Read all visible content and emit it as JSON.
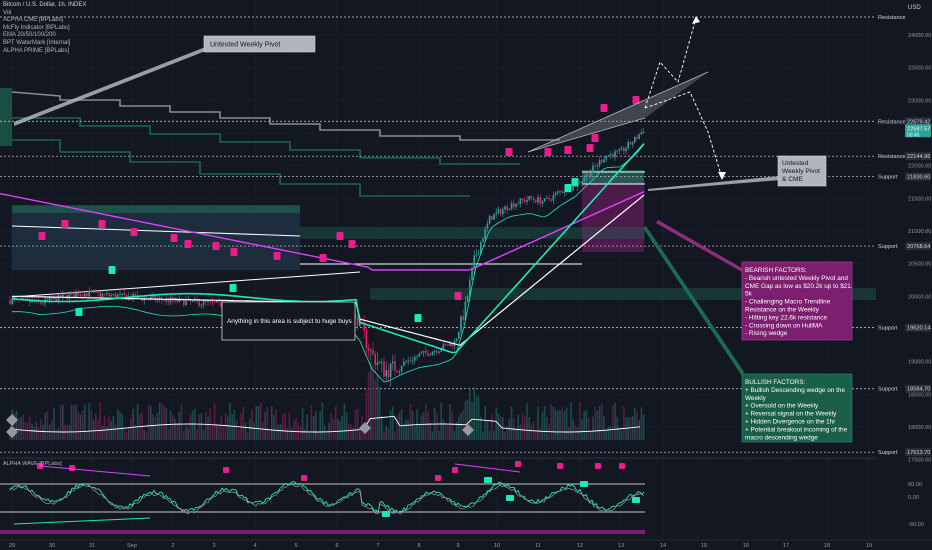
{
  "chart_data": {
    "type": "candlestick",
    "title": "Bitcoin / U.S. Dollar, 1h, INDEX",
    "indicators": [
      "Vol",
      "ALPHA CME [BPLabs]",
      "McFly Indicator [BPLabs]",
      "EMA 20/50/100/200",
      "BPT WaterMark [Internal]",
      "ALPHA PRIME [BPLabs]"
    ],
    "currency": "USD",
    "y_axis_ticks": [
      24000,
      23500,
      23000,
      22500,
      22000,
      21500,
      21000,
      20500,
      20000,
      19500,
      19000,
      18500,
      18000,
      17500
    ],
    "wave_axis_ticks": [
      "60.00",
      "0.00",
      "-60.00"
    ],
    "x_axis_labels": [
      "29",
      "30",
      "31",
      "Sep",
      "2",
      "3",
      "4",
      "5",
      "6",
      "7",
      "8",
      "9",
      "10",
      "11",
      "12",
      "13",
      "14",
      "15",
      "16",
      "17",
      "18",
      "19"
    ],
    "price_levels": [
      {
        "value": "22144.96",
        "tag": "Resistance"
      },
      {
        "value": "22679.42",
        "tag": "Resistance"
      },
      {
        "value": "21830.60",
        "tag": "Support"
      },
      {
        "value": "20768.64",
        "tag": "Support"
      },
      {
        "value": "19520.14",
        "tag": "Support"
      },
      {
        "value": "18584.70",
        "tag": "Support"
      },
      {
        "value": "17613.70",
        "tag": "Support"
      }
    ],
    "top_level_tag": "Resistance",
    "current_price": "22587.57",
    "current_price_sub": "50:45",
    "panes": {
      "wave_label": "ALPHA WAVE [BPLabs]"
    },
    "annotations": {
      "untested_pivot_top": "Untested Weekly Pivot",
      "untested_pivot_right": [
        "Untested",
        "Weekly Pivot",
        "& CME"
      ],
      "huge_buys": "Anything in this area is subject to huge buys",
      "bearish_title": "BEARISH FACTORS:",
      "bearish_lines": [
        "- Bearish untested Weekly Pivot and",
        "CME Gap as low as $20.2k up to $21.",
        "5k",
        "- Challenging Macro Trendline",
        "Resistance on the Weekly",
        "- Hitting key 22.6k resistance",
        "- Crossing down on HullMA",
        "- Rising wedge"
      ],
      "bullish_title": "BULLISH FACTORS:",
      "bullish_lines": [
        "+ Bullish Descending wedge on the",
        "Weekly",
        "+ Oversold on the Weekly",
        "+ Reversal signal on the Weekly",
        "+ Hidden Divergence on the 1hr",
        "+ Potential breakout incoming of the",
        "macro descending wedge"
      ]
    },
    "colors": {
      "background": "#131722",
      "up_candle": "#26a69a",
      "down_candle": "#e91e63",
      "magenta_ma": "#e040fb",
      "white_ma": "#ffffff",
      "teal_ma": "#1de9b6",
      "bearish_box": "#7b1f6e",
      "bullish_box": "#1b5e4a"
    }
  }
}
